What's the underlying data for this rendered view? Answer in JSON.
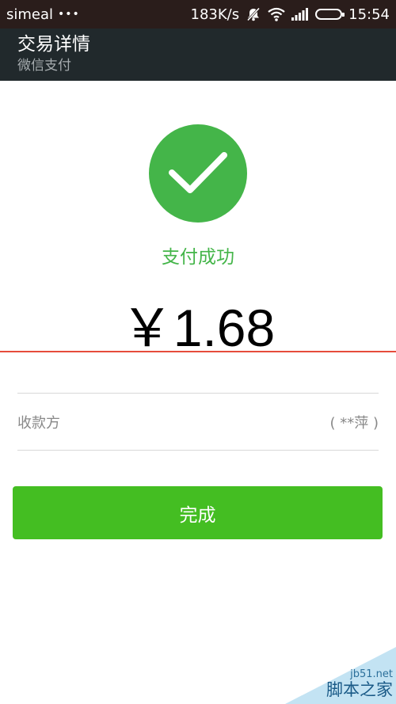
{
  "status_bar": {
    "carrier": "simeal",
    "dots": "•••",
    "net_speed": "183K/s",
    "time": "15:54",
    "icons": [
      "muted-bell-icon",
      "wifi-icon",
      "signal-icon",
      "battery-icon"
    ],
    "battery_level_fraction": 1.0
  },
  "header": {
    "title": "交易详情",
    "subtitle": "微信支付"
  },
  "result": {
    "icon": "checkmark-icon",
    "status_text": "支付成功",
    "amount": "￥1.68"
  },
  "payee": {
    "label": "收款方",
    "value": "( **萍 )"
  },
  "actions": {
    "done_label": "完成"
  },
  "watermark": {
    "url": "jb51.net",
    "name": "脚本之家"
  },
  "colors": {
    "status_bar_bg": "#2a1d1b",
    "title_bar_bg": "#21292c",
    "success_green": "#44b549",
    "button_green": "#44be22"
  }
}
